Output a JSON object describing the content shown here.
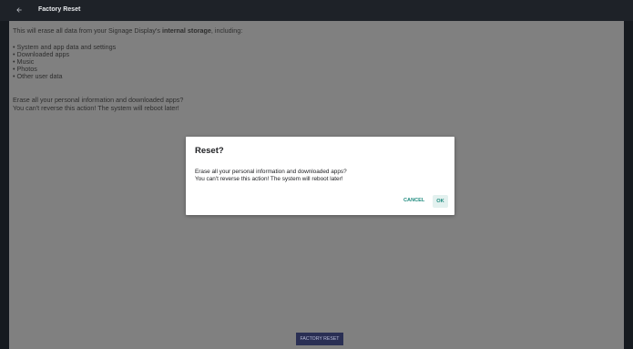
{
  "appbar": {
    "title": "Factory Reset",
    "back_icon": "arrow-back-icon"
  },
  "content": {
    "intro_prefix": "This will erase all data from your Signage Display's ",
    "intro_bold": "internal storage",
    "intro_suffix": ", including:",
    "bullets": [
      "System and app data and settings",
      "Downloaded apps",
      "Music",
      "Photos",
      "Other user data"
    ],
    "warning_line1": "Erase all your personal information and downloaded apps?",
    "warning_line2": "You can't reverse this action! The system will reboot later!",
    "factory_reset_label": "FACTORY RESET"
  },
  "dialog": {
    "title": "Reset?",
    "message_line1": "Erase all your personal information and downloaded apps?",
    "message_line2": "You can't reverse this action! The system will reboot later!",
    "cancel_label": "CANCEL",
    "ok_label": "OK"
  },
  "colors": {
    "appbar_bg": "#1e2228",
    "content_scrim": "#808080",
    "dialog_bg": "#ffffff",
    "accent": "#1e8a7e",
    "factory_button_bg": "#2a2f54"
  }
}
